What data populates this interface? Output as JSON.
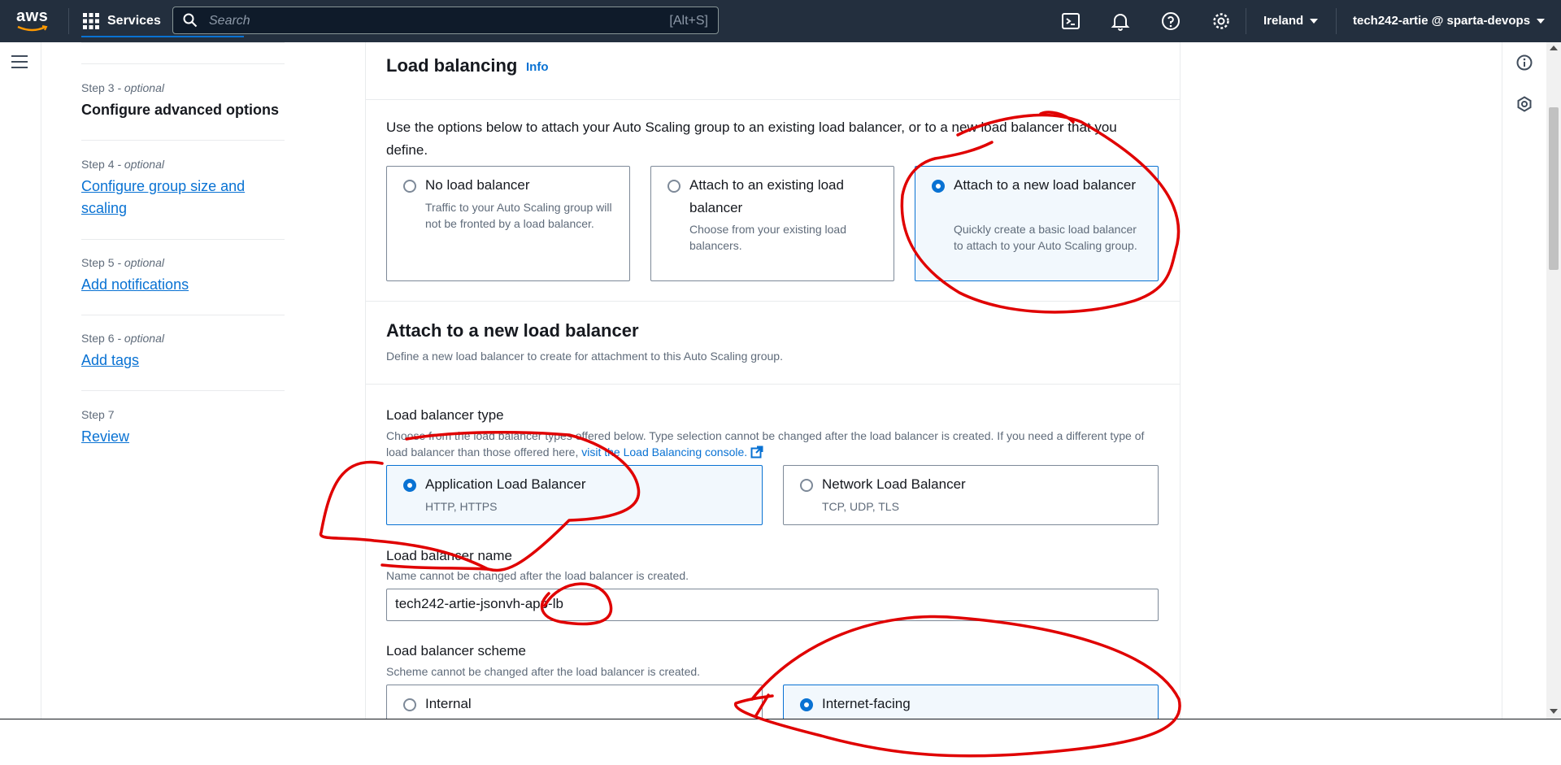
{
  "topbar": {
    "logo_text": "aws",
    "services_label": "Services",
    "search_placeholder": "Search",
    "search_shortcut": "[Alt+S]",
    "region": "Ireland",
    "account": "tech242-artie @ sparta-devops",
    "icons": [
      "cloudshell-icon",
      "bell-icon",
      "help-icon",
      "settings-icon"
    ]
  },
  "steps": [
    {
      "label": "Step 3",
      "optional": " - optional",
      "title": "Configure advanced options",
      "current": true
    },
    {
      "label": "Step 4",
      "optional": " - optional",
      "title": "Configure group size and scaling",
      "current": false
    },
    {
      "label": "Step 5",
      "optional": " - optional",
      "title": "Add notifications",
      "current": false
    },
    {
      "label": "Step 6",
      "optional": " - optional",
      "title": "Add tags",
      "current": false
    },
    {
      "label": "Step 7",
      "optional": "",
      "title": "Review",
      "current": false
    }
  ],
  "load_balancing": {
    "heading": "Load balancing",
    "info_link": "Info",
    "description": "Use the options below to attach your Auto Scaling group to an existing load balancer, or to a new load balancer that you define.",
    "options": [
      {
        "title": "No load balancer",
        "desc": "Traffic to your Auto Scaling group will not be fronted by a load balancer.",
        "selected": false
      },
      {
        "title": "Attach to an existing load balancer",
        "desc": "Choose from your existing load balancers.",
        "selected": false
      },
      {
        "title": "Attach to a new load balancer",
        "desc": "Quickly create a basic load balancer to attach to your Auto Scaling group.",
        "selected": true
      }
    ]
  },
  "new_lb": {
    "heading": "Attach to a new load balancer",
    "description": "Define a new load balancer to create for attachment to this Auto Scaling group.",
    "type_label": "Load balancer type",
    "type_desc": "Choose from the load balancer types offered below. Type selection cannot be changed after the load balancer is created. If you need a different type of load balancer than those offered here, ",
    "type_link": "visit the Load Balancing console.",
    "types": [
      {
        "title": "Application Load Balancer",
        "desc": "HTTP, HTTPS",
        "selected": true
      },
      {
        "title": "Network Load Balancer",
        "desc": "TCP, UDP, TLS",
        "selected": false
      }
    ],
    "name_label": "Load balancer name",
    "name_desc": "Name cannot be changed after the load balancer is created.",
    "name_value": "tech242-artie-jsonvh-app-lb",
    "scheme_label": "Load balancer scheme",
    "scheme_desc": "Scheme cannot be changed after the load balancer is created.",
    "schemes": [
      {
        "title": "Internal",
        "selected": false
      },
      {
        "title": "Internet-facing",
        "selected": true
      }
    ]
  },
  "colors": {
    "topbar_bg": "#232f3e",
    "link": "#0972d3",
    "selected_bg": "#f2f8fd",
    "annotation": "#e00000"
  }
}
